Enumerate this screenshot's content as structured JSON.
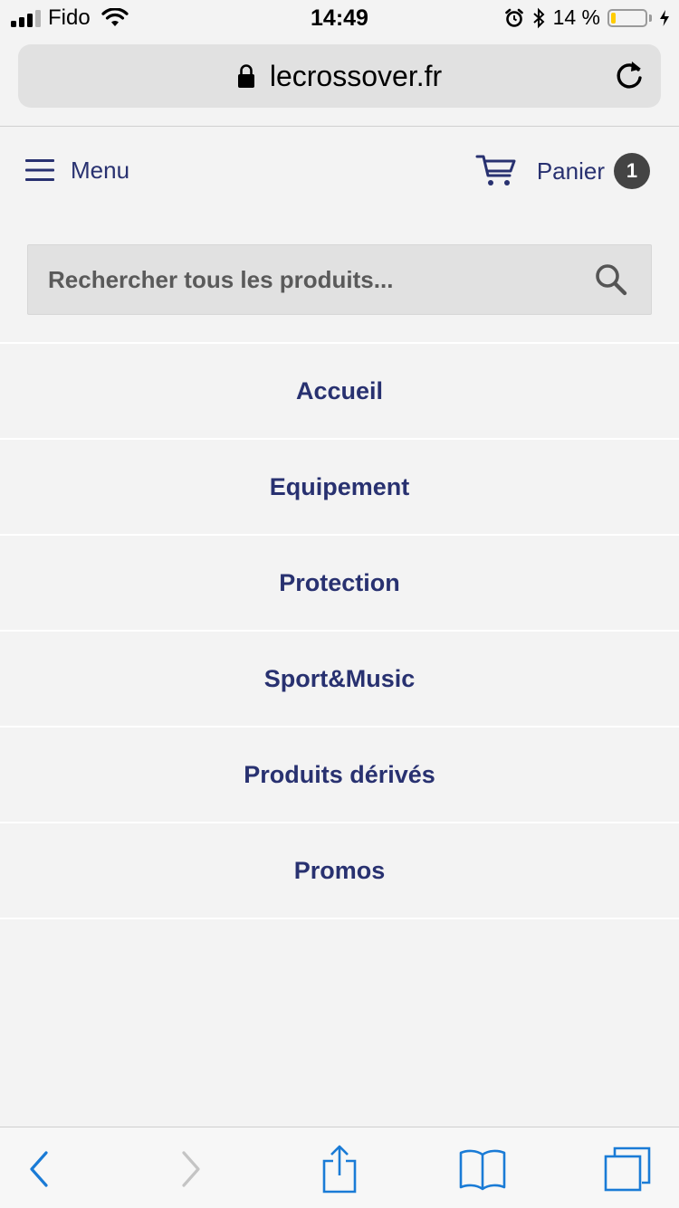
{
  "status_bar": {
    "carrier": "Fido",
    "time": "14:49",
    "battery_percent": "14 %",
    "battery_level": 0.14,
    "signal_bars_active": 3,
    "signal_bars_total": 4
  },
  "browser": {
    "url": "lecrossover.fr"
  },
  "header": {
    "menu_label": "Menu",
    "cart_label": "Panier",
    "cart_count": "1"
  },
  "search": {
    "placeholder": "Rechercher tous les produits..."
  },
  "nav": {
    "items": [
      {
        "label": "Accueil"
      },
      {
        "label": "Equipement"
      },
      {
        "label": "Protection"
      },
      {
        "label": "Sport&Music"
      },
      {
        "label": "Produits dérivés"
      },
      {
        "label": "Promos"
      }
    ]
  },
  "colors": {
    "brand_navy": "#283170",
    "ios_blue": "#1a7bd6",
    "badge": "#444444",
    "battery_low": "#ffcc00"
  },
  "icons": {
    "menu": "hamburger-icon",
    "cart": "cart-icon",
    "search": "magnifier-icon",
    "lock": "lock-icon",
    "reload": "reload-icon",
    "back": "chevron-left-icon",
    "forward": "chevron-right-icon",
    "share": "share-icon",
    "bookmarks": "book-icon",
    "tabs": "tabs-icon"
  }
}
